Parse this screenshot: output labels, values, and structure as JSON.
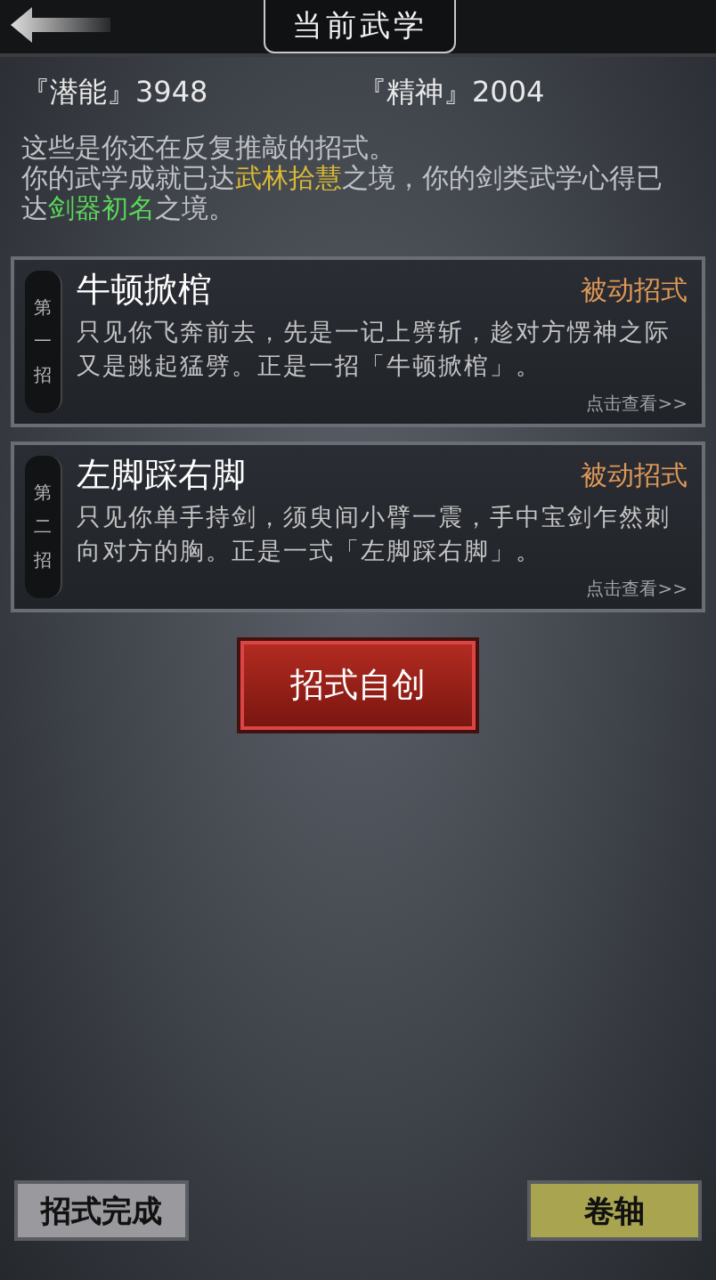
{
  "header": {
    "title": "当前武学"
  },
  "stats": [
    {
      "label": "『潜能』",
      "value": "3948"
    },
    {
      "label": "『精神』",
      "value": "2004"
    }
  ],
  "description": [
    [
      {
        "text": "这些是你还在反复推敲的招式。"
      }
    ],
    [
      {
        "text": "你的武学成就已达"
      },
      {
        "text": "武林拾慧",
        "color": "#d8b838"
      },
      {
        "text": "之境，你的剑类武学心得已达"
      },
      {
        "text": "剑器初名",
        "color": "#5ad85a"
      },
      {
        "text": "之境。"
      }
    ]
  ],
  "moves": [
    {
      "order": "第一招",
      "name": "牛顿掀棺",
      "type": "被动招式",
      "text": "只见你飞奔前去，先是一记上劈斩，趁对方愣神之际又是跳起猛劈。正是一招「牛顿掀棺」。",
      "link": "点击查看>>"
    },
    {
      "order": "第二招",
      "name": "左脚踩右脚",
      "type": "被动招式",
      "text": "只见你单手持剑，须臾间小臂一震，手中宝剑乍然刺向对方的胸。正是一式「左脚踩右脚」。",
      "link": "点击查看>>"
    }
  ],
  "create_button": "招式自创",
  "bottom_buttons": [
    {
      "label": "招式完成",
      "selected": false
    },
    {
      "label": "卷轴",
      "selected": true
    }
  ]
}
